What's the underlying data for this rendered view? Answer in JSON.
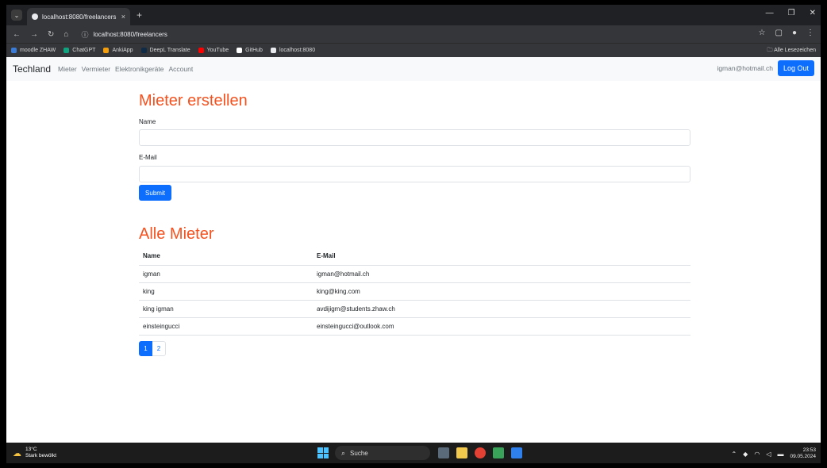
{
  "browser": {
    "tab_title": "localhost:8080/freelancers",
    "tab_close": "×",
    "new_tab": "+",
    "url": "localhost:8080/freelancers",
    "bookmarks": [
      {
        "label": "moodle ZHAW",
        "color": "#3a7bd5"
      },
      {
        "label": "ChatGPT",
        "color": "#10a37f"
      },
      {
        "label": "AnkiApp",
        "color": "#f59e0b"
      },
      {
        "label": "DeepL Translate",
        "color": "#0f2b46"
      },
      {
        "label": "YouTube",
        "color": "#ff0000"
      },
      {
        "label": "GitHub",
        "color": "#ffffff"
      },
      {
        "label": "localhost:8080",
        "color": "#e8eaed"
      }
    ],
    "all_bookmarks": "Alle Lesezeichen"
  },
  "navbar": {
    "brand": "Techland",
    "links": [
      "Mieter",
      "Vermieter",
      "Elektronikgeräte",
      "Account"
    ],
    "user_email": "igman@hotmail.ch",
    "logout_label": "Log Out"
  },
  "form": {
    "title": "Mieter erstellen",
    "name_label": "Name",
    "name_value": "",
    "email_label": "E-Mail",
    "email_value": "",
    "submit_label": "Submit"
  },
  "list": {
    "title": "Alle Mieter",
    "columns": [
      "Name",
      "E-Mail"
    ],
    "rows": [
      [
        "igman",
        "igman@hotmail.ch"
      ],
      [
        "king",
        "king@king.com"
      ],
      [
        "king igman",
        "avdijigm@students.zhaw.ch"
      ],
      [
        "einsteingucci",
        "einsteingucci@outlook.com"
      ]
    ],
    "pages": [
      "1",
      "2"
    ],
    "active_page": "1"
  },
  "taskbar": {
    "temperature": "13°C",
    "weather": "Stark bewölkt",
    "search_label": "Suche",
    "time": "23:53",
    "date": "09.05.2024"
  },
  "colors": {
    "accent": "#0d6efd",
    "heading": "#f4511e"
  }
}
